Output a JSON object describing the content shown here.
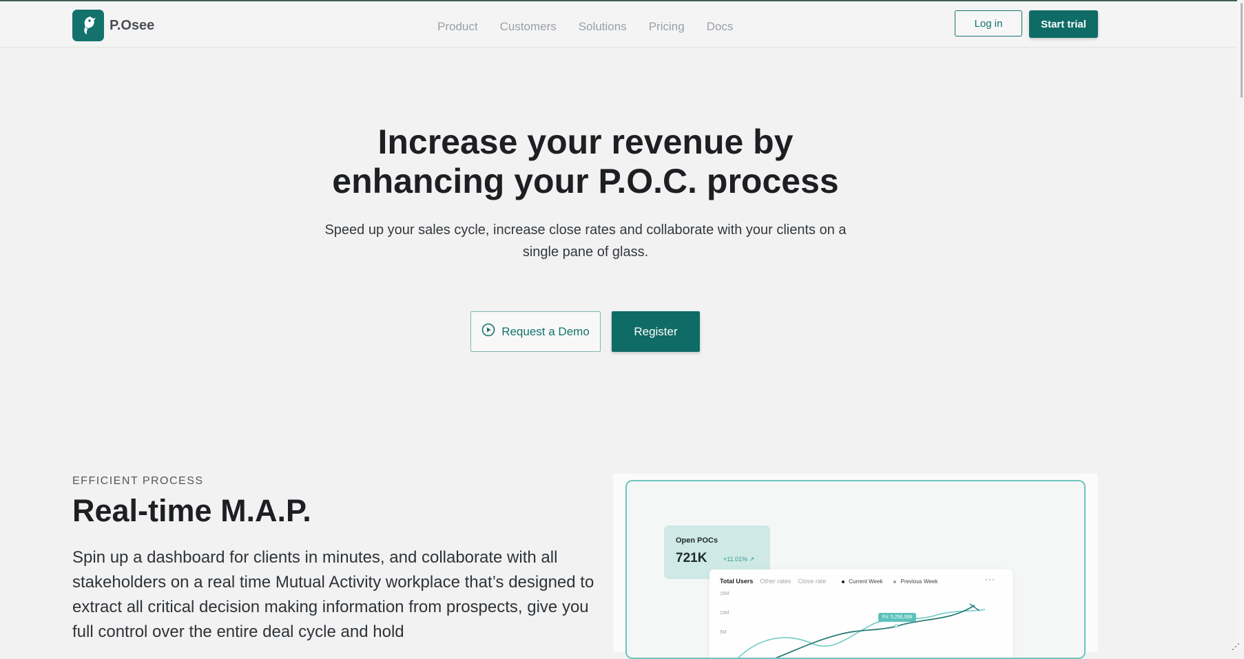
{
  "brand": {
    "name": "P.Osee",
    "color": "#14726c"
  },
  "nav": {
    "links": [
      {
        "label": "Product"
      },
      {
        "label": "Customers"
      },
      {
        "label": "Solutions"
      },
      {
        "label": "Pricing"
      },
      {
        "label": "Docs"
      }
    ],
    "login_label": "Log in",
    "trial_label": "Start trial"
  },
  "hero": {
    "title_line1": "Increase your revenue by",
    "title_line2": "enhancing your P.O.C. process",
    "subtitle_line1": "Speed up your sales cycle, increase close rates and collaborate with your clients on a",
    "subtitle_line2": "single pane of glass.",
    "demo_label": "Request a Demo",
    "demo_icon": "play-circle-icon",
    "register_label": "Register"
  },
  "section": {
    "eyebrow": "EFFICIENT PROCESS",
    "title": "Real-time M.A.P.",
    "body": "Spin up a dashboard for clients in minutes, and collaborate with all stakeholders on a real time Mutual Activity workplace that’s designed to extract all critical decision making information from prospects, give you full control over the entire deal cycle and hold"
  },
  "preview": {
    "open_pocs": {
      "label": "Open POCs",
      "value": "721K",
      "change": "+11.01%"
    },
    "chart": {
      "tabs": [
        "Total Users",
        "Other rates",
        "Close rate"
      ],
      "legend": [
        "Current Week",
        "Previous Week"
      ],
      "more_icon": "more-dots-icon",
      "yticks": [
        "15M",
        "10M",
        "5M"
      ],
      "tooltip": "Fri: 5,256,568",
      "colors": {
        "current": "#2a7d78",
        "previous": "#6ecbc4"
      }
    }
  },
  "colors": {
    "accent": "#0f6b66",
    "background": "#f2f2f2"
  }
}
